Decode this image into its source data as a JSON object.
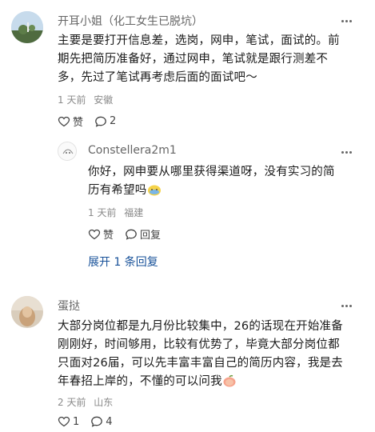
{
  "comments": [
    {
      "username": "开耳小姐（化工女生已脱坑）",
      "lines": [
        "主要是要打开信息差，选岗，网申，笔试，面试的。前",
        "期先把简历准备好，通过网申，笔试就是跟行测差不",
        "多，先过了笔试再考虑后面的面试吧～"
      ],
      "time": "1 天前",
      "location": "安徽",
      "like_label": "赞",
      "reply_count": "2",
      "replies": [
        {
          "username": "Constellera2m1",
          "lines": [
            "你好，网申要从哪里获得渠道呀，没有实习的简",
            "历有希望吗"
          ],
          "time": "1 天前",
          "location": "福建",
          "like_label": "赞",
          "reply_label": "回复"
        }
      ],
      "expand_label": "展开 1 条回复"
    },
    {
      "username": "蛋挞",
      "lines": [
        "大部分岗位都是九月份比较集中，26的话现在开始准备",
        "刚刚好，时间够用，比较有优势了，毕竟大部分岗位都",
        "只面对26届，可以先丰富丰富自己的简历内容，我是去",
        "年春招上岸的，不懂的可以问我"
      ],
      "time": "2 天前",
      "location": "山东",
      "like_count": "1",
      "reply_count": "4"
    }
  ],
  "colors": {
    "link": "#175199",
    "meta": "#8a8a8a"
  }
}
